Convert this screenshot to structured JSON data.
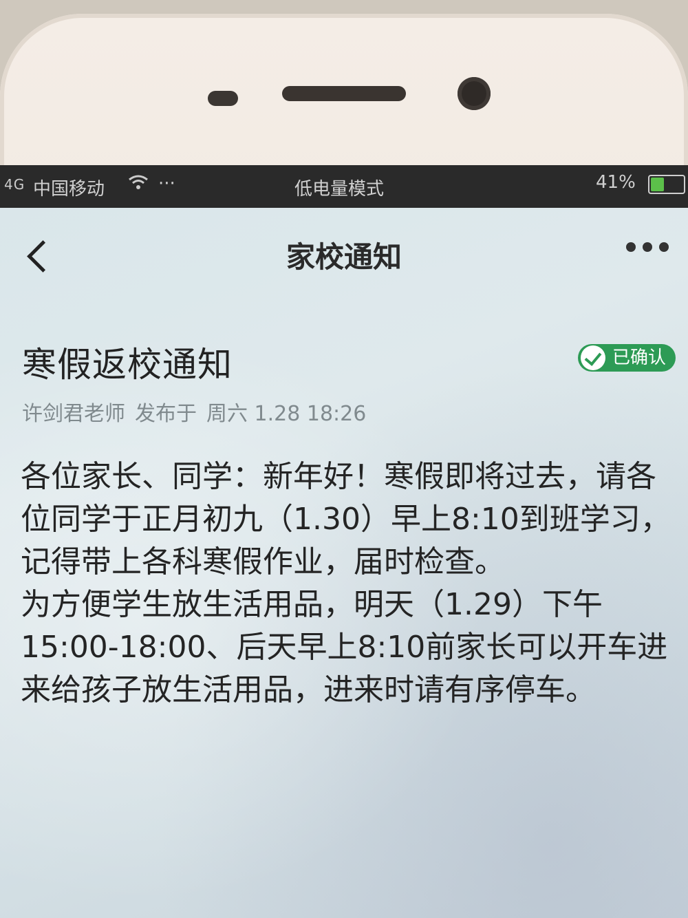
{
  "status_bar": {
    "signal": "4G",
    "carrier": "中国移动",
    "wifi_icon": "wifi-icon",
    "more": "···",
    "mode": "低电量模式",
    "battery_percent": "41%",
    "battery_level": 0.41
  },
  "nav": {
    "back_icon": "chevron-left-icon",
    "title": "家校通知",
    "more_icon": "more-dots-icon"
  },
  "notice": {
    "title": "寒假返校通知",
    "status_badge": "已确认",
    "author": "许剑君老师",
    "published_label": "发布于",
    "published_time": "周六 1.28 18:26",
    "paragraph1": "各位家长、同学：新年好！寒假即将过去，请各位同学于正月初九（1.30）早上8:10到班学习，记得带上各科寒假作业，届时检查。",
    "paragraph2": "为方便学生放生活用品，明天（1.29）下午15:00-18:00、后天早上8:10前家长可以开车进来给孩子放生活用品，进来时请有序停车。"
  },
  "colors": {
    "badge_green": "#2d9b55",
    "status_bar_bg": "#2a2a2a",
    "meta_text": "#808a8e"
  }
}
